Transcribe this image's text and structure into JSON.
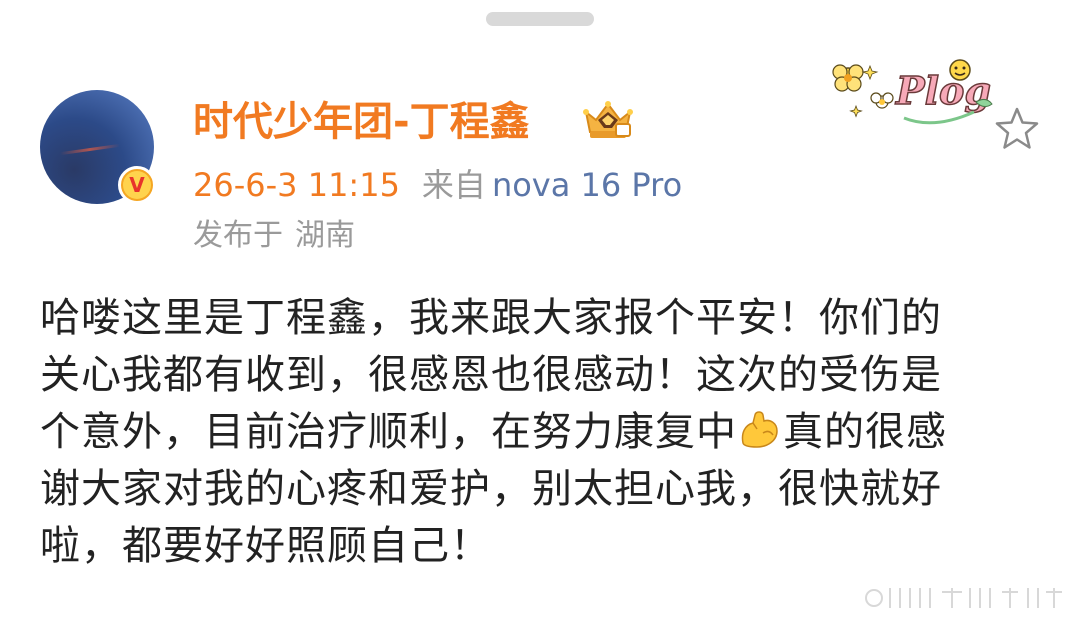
{
  "post": {
    "author": {
      "name": "时代少年团-丁程鑫",
      "verified": true,
      "avatar_icon": "avatar-photo"
    },
    "time": "26-6-3 11:15",
    "from_label": "来自",
    "device": "nova 16 Pro",
    "location_label": "发布于",
    "location": "湖南",
    "body_lines": [
      "哈喽这里是丁程鑫，我来跟大家报个平安！你们的",
      "关心我都有收到，很感恩也很感动！这次的受伤是",
      "个意外，目前治疗顺利，在努力康复中",
      "真的很感",
      "谢大家对我的心疼和爱护，别太担心我，很快就好",
      "啦，都要好好照顾自己！"
    ]
  },
  "sticker": {
    "text": "Plog"
  },
  "colors": {
    "accent_orange": "#f17a21",
    "meta_gray": "#9a9a9a",
    "device_blue": "#5b76a8",
    "body_text": "#222222"
  },
  "icons": {
    "verified": "verified-v-icon",
    "crown": "crown-badge-icon",
    "star": "star-outline-icon",
    "emoji": "flexed-biceps-emoji"
  }
}
